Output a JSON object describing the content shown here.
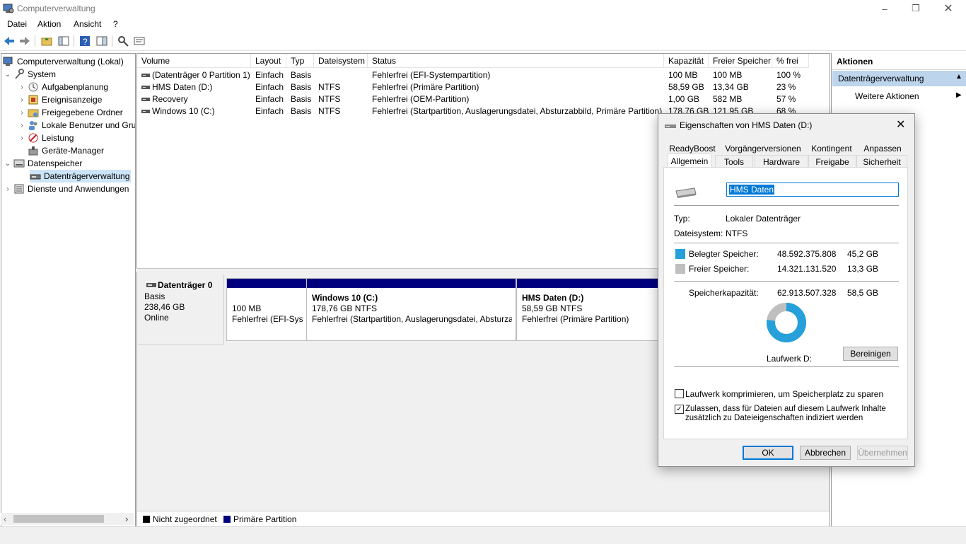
{
  "window": {
    "title": "Computerverwaltung"
  },
  "menu": [
    "Datei",
    "Aktion",
    "Ansicht",
    "?"
  ],
  "tree": {
    "root": "Computerverwaltung (Lokal)",
    "system": "System",
    "system_items": [
      "Aufgabenplanung",
      "Ereignisanzeige",
      "Freigegebene Ordner",
      "Lokale Benutzer und Gruppen",
      "Leistung",
      "Geräte-Manager"
    ],
    "storage": "Datenspeicher",
    "disk_mgmt": "Datenträgerverwaltung",
    "services": "Dienste und Anwendungen"
  },
  "volumes": {
    "headers": [
      "Volume",
      "Layout",
      "Typ",
      "Dateisystem",
      "Status",
      "Kapazität",
      "Freier Speicher",
      "% frei"
    ],
    "rows": [
      [
        "(Datenträger 0 Partition 1)",
        "Einfach",
        "Basis",
        "",
        "Fehlerfrei (EFI-Systempartition)",
        "100 MB",
        "100 MB",
        "100 %"
      ],
      [
        "HMS Daten (D:)",
        "Einfach",
        "Basis",
        "NTFS",
        "Fehlerfrei (Primäre Partition)",
        "58,59 GB",
        "13,34 GB",
        "23 %"
      ],
      [
        "Recovery",
        "Einfach",
        "Basis",
        "NTFS",
        "Fehlerfrei (OEM-Partition)",
        "1,00 GB",
        "582 MB",
        "57 %"
      ],
      [
        "Windows 10 (C:)",
        "Einfach",
        "Basis",
        "NTFS",
        "Fehlerfrei (Startpartition, Auslagerungsdatei, Absturzabbild, Primäre Partition)",
        "178,76 GB",
        "121,95 GB",
        "68 %"
      ]
    ]
  },
  "disk": {
    "name": "Datenträger 0",
    "type": "Basis",
    "size": "238,46 GB",
    "state": "Online",
    "partitions": [
      {
        "title": "",
        "size": "100 MB",
        "status": "Fehlerfrei (EFI-Systempartition)"
      },
      {
        "title": "Windows 10  (C:)",
        "size": "178,76 GB NTFS",
        "status": "Fehlerfrei (Startpartition, Auslagerungsdatei, Absturzabbild, Primäre Partition)"
      },
      {
        "title": "HMS Daten  (D:)",
        "size": "58,59 GB NTFS",
        "status": "Fehlerfrei (Primäre Partition)"
      }
    ]
  },
  "legend": [
    "Nicht zugeordnet",
    "Primäre Partition"
  ],
  "actions": {
    "header": "Aktionen",
    "section": "Datenträgerverwaltung",
    "more": "Weitere Aktionen"
  },
  "dialog": {
    "title": "Eigenschaften von HMS Daten (D:)",
    "tabs_row1": [
      "ReadyBoost",
      "Vorgängerversionen",
      "Kontingent",
      "Anpassen"
    ],
    "tabs_row2": [
      "Allgemein",
      "Tools",
      "Hardware",
      "Freigabe",
      "Sicherheit"
    ],
    "name_value": "HMS Daten",
    "type_label": "Typ:",
    "type_value": "Lokaler Datenträger",
    "fs_label": "Dateisystem:",
    "fs_value": "NTFS",
    "used_label": "Belegter Speicher:",
    "used_bytes": "48.592.375.808",
    "used_gb": "45,2 GB",
    "free_label": "Freier Speicher:",
    "free_bytes": "14.321.131.520",
    "free_gb": "13,3 GB",
    "cap_label": "Speicherkapazität:",
    "cap_bytes": "62.913.507.328",
    "cap_gb": "58,5 GB",
    "used_fraction": 0.772,
    "drive_label": "Laufwerk D:",
    "cleanup_button": "Bereinigen",
    "compress_label": "Laufwerk komprimieren, um Speicherplatz zu sparen",
    "compress_checked": false,
    "index_label_1": "Zulassen, dass für Dateien auf diesem Laufwerk Inhalte",
    "index_label_2": "zusätzlich zu Dateieigenschaften indiziert werden",
    "index_checked": true,
    "ok": "OK",
    "cancel": "Abbrechen",
    "apply": "Übernehmen"
  },
  "colors": {
    "used": "#26a0da",
    "free": "#bfbfbf",
    "partition_header": "#00007f",
    "selection": "#cce4f7"
  }
}
